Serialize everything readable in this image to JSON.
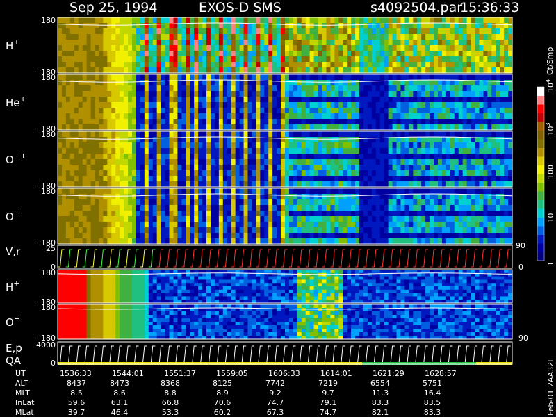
{
  "header": {
    "date": "Sep 25, 1994",
    "instrument": "EXOS-D SMS",
    "file": "s4092504.par",
    "time": "15:36:33"
  },
  "chart_data": {
    "type": "heatmap",
    "panels": [
      {
        "id": "hplus",
        "label": "H",
        "sup": "+",
        "ytick_top": "180",
        "ytick_bottom": "−180",
        "ylim": [
          -180,
          180
        ],
        "kind": "spectrogram"
      },
      {
        "id": "heplus",
        "label": "He",
        "sup": "+",
        "ytick_top": "180",
        "ytick_bottom": "−180",
        "ylim": [
          -180,
          180
        ],
        "kind": "spectrogram"
      },
      {
        "id": "oplusplus",
        "label": "O",
        "sup": "++",
        "ytick_top": "180",
        "ytick_bottom": "−180",
        "ylim": [
          -180,
          180
        ],
        "kind": "spectrogram"
      },
      {
        "id": "oplus",
        "label": "O",
        "sup": "+",
        "ytick_top": "180",
        "ytick_bottom": "−180",
        "ylim": [
          -180,
          180
        ],
        "kind": "spectrogram"
      },
      {
        "id": "vr",
        "label": "V,r",
        "sup": "",
        "ytick_top": "25",
        "ytick_bottom": "0",
        "right_top": "90",
        "right_bottom": "0",
        "ylim": [
          0,
          25
        ],
        "kind": "line"
      },
      {
        "id": "hplus2",
        "label": "H",
        "sup": "+",
        "ytick_top": "180",
        "ytick_bottom": "−180",
        "ylim": [
          -180,
          180
        ],
        "kind": "spectrogram"
      },
      {
        "id": "oplus2",
        "label": "O",
        "sup": "+",
        "ytick_top": "180",
        "ytick_bottom": "−180",
        "right_bottom": "90",
        "ylim": [
          -180,
          180
        ],
        "kind": "spectrogram"
      },
      {
        "id": "ep",
        "label": "E,p",
        "label2": "QA",
        "sup": "",
        "ytick_top": "4000",
        "ytick_bottom": "0",
        "ylim": [
          0,
          4000
        ],
        "kind": "line"
      }
    ],
    "colorbar": {
      "title": "Ct/Smp",
      "tick_labels": [
        {
          "value": 1,
          "text": "1"
        },
        {
          "value": 10,
          "text": "10"
        },
        {
          "value": 100,
          "text": "100"
        },
        {
          "value": 1000,
          "text": "10",
          "sup": "3"
        },
        {
          "value": 10000,
          "text": "10",
          "sup": "4"
        }
      ],
      "scale": "log",
      "range": [
        1,
        10000
      ],
      "colors": [
        "#000080",
        "#0000a0",
        "#0018c0",
        "#0060e0",
        "#00a0ff",
        "#00d0d0",
        "#20c080",
        "#40b040",
        "#80c000",
        "#c0d800",
        "#f0f000",
        "#d8c800",
        "#b09000",
        "#807000",
        "#806000",
        "#a06000",
        "#c00000",
        "#ff0000",
        "#ff8080",
        "#ffffff"
      ]
    },
    "table": {
      "row_labels": [
        "UT",
        "ALT",
        "MLT",
        "InLat",
        "MLat"
      ],
      "columns": [
        [
          "1536:33",
          "8437",
          "8.5",
          "59.6",
          "39.7"
        ],
        [
          "1544:01",
          "8473",
          "8.6",
          "63.1",
          "46.4"
        ],
        [
          "1551:37",
          "8368",
          "8.8",
          "66.8",
          "53.3"
        ],
        [
          "1559:05",
          "8125",
          "8.9",
          "70.6",
          "60.2"
        ],
        [
          "1606:33",
          "7742",
          "9.2",
          "74.7",
          "67.3"
        ],
        [
          "1614:01",
          "7219",
          "9.7",
          "79.1",
          "74.7"
        ],
        [
          "1621:29",
          "6554",
          "11.3",
          "83.3",
          "82.1"
        ],
        [
          "1628:57",
          "5751",
          "16.4",
          "83.5",
          "83.3"
        ]
      ]
    },
    "side_note": "Feb-01 2AA32L",
    "legend_placement": "right",
    "grid": false
  }
}
